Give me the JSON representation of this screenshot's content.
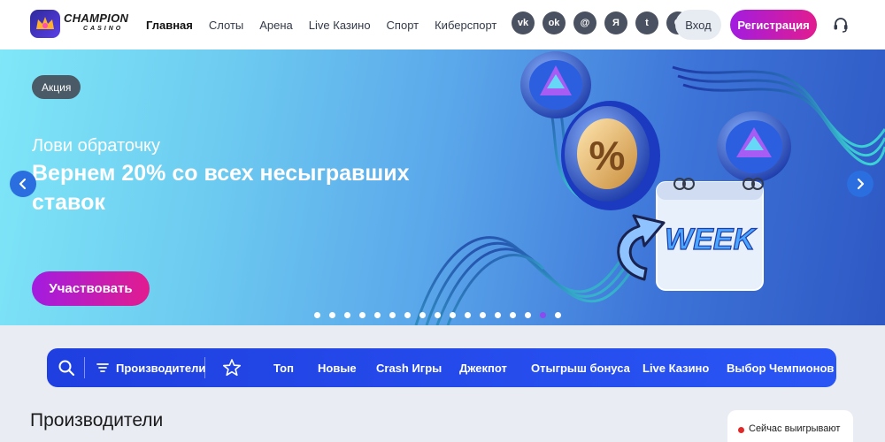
{
  "brand": {
    "title": "CHAMPION",
    "subtitle": "CASINO"
  },
  "nav": {
    "items": [
      {
        "label": "Главная",
        "active": true
      },
      {
        "label": "Слоты"
      },
      {
        "label": "Арена"
      },
      {
        "label": "Live Казино"
      },
      {
        "label": "Спорт"
      },
      {
        "label": "Киберспорт"
      }
    ],
    "more": "•••"
  },
  "socials": [
    {
      "icon": "vk-icon",
      "glyph": "vk"
    },
    {
      "icon": "odnoklassniki-icon",
      "glyph": "ok"
    },
    {
      "icon": "mail-icon",
      "glyph": "@"
    },
    {
      "icon": "yandex-icon",
      "glyph": "Я"
    },
    {
      "icon": "twitter-icon",
      "glyph": "t"
    },
    {
      "icon": "google-icon",
      "glyph": "G"
    }
  ],
  "auth": {
    "login": "Вход",
    "register": "Регистрация"
  },
  "banner": {
    "badge": "Акция",
    "subtitle": "Лови обраточку",
    "title": "Вернем 20% со всех несыгравших ставок",
    "cta": "Участвовать",
    "art_text": "WEEK",
    "art_percent": "%",
    "slides_total": 17,
    "active_slide": 16
  },
  "filter": {
    "providers_label": "Производители",
    "categories": [
      "Топ",
      "Новые",
      "Crash Игры",
      "Джекпот",
      "Отыгрыш бонуса",
      "Live Казино",
      "Выбор Чемпионов"
    ]
  },
  "section": {
    "title": "Производители"
  },
  "winning": {
    "label": "Сейчас выигрывают"
  },
  "colors": {
    "accent": "#2a55f5",
    "cta_start": "#a21ce0",
    "cta_end": "#e21c8f",
    "live_dot": "#e02a2a"
  }
}
